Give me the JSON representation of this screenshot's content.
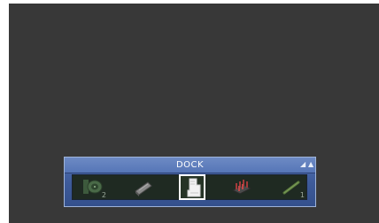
{
  "dock": {
    "title": "DOCK",
    "controls": {
      "resize_icon": "resize-icon",
      "collapse_icon": "collapse-icon",
      "resize_glyph": "◢",
      "collapse_glyph": "▲"
    },
    "slots": [
      {
        "name": "satellite-dish-tool",
        "icon": "satellite-dish-icon",
        "count": "2",
        "selected": false
      },
      {
        "name": "panel-tool",
        "icon": "panel-icon",
        "count": "",
        "selected": false
      },
      {
        "name": "document-tool",
        "icon": "document-icon",
        "count": "",
        "selected": true
      },
      {
        "name": "battery-rack-tool",
        "icon": "battery-rack-icon",
        "count": "",
        "selected": false
      },
      {
        "name": "rod-tool",
        "icon": "rod-icon",
        "count": "1",
        "selected": false
      }
    ]
  }
}
